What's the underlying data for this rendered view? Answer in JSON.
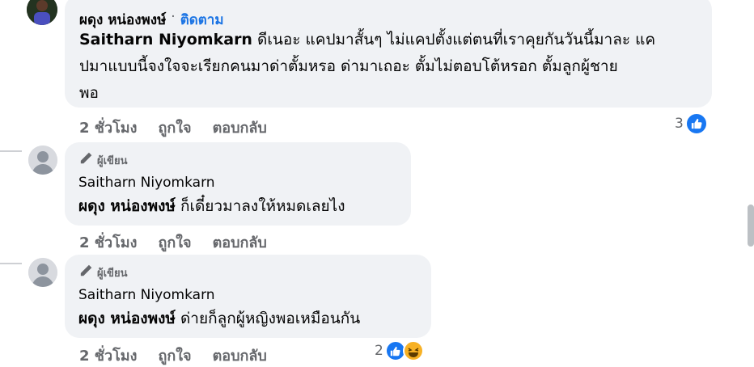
{
  "colors": {
    "link": "#1b74e4",
    "bubble": "#f0f2f5",
    "muted": "#65676b",
    "like": "#1877f2"
  },
  "main_comment": {
    "author": "ผดุง หน่องพงษ์",
    "separator": "·",
    "follow_label": "ติดตาม",
    "mention": "Saitharn Niyomkarn",
    "text_line1": " ดีเนอะ แคปมาสั้นๆ ไม่แคปตั้งแต่ตนที่เราคุยกันวันนี้มาละ แค",
    "text_line2": "ปมาแบบนี้จงใจจะเรียกคนมาด่าตั้มหรอ ด่ามาเถอะ ตั้มไม่ตอบโต้หรอก ตั้มลูกผู้ชาย",
    "text_line3": "พอ",
    "time": "2 ชั่วโมง",
    "like_label": "ถูกใจ",
    "reply_label": "ตอบกลับ",
    "reaction_count": "3",
    "reaction_icons": [
      "like-icon"
    ]
  },
  "replies": [
    {
      "author_badge": "ผู้เขียน",
      "author_badge_icon": "pencil-icon",
      "author": "Saitharn Niyomkarn",
      "mention": "ผดุง หน่องพงษ์",
      "text": " ก็เดี๋ยวมาลงให้หมดเลยไง",
      "time": "2 ชั่วโมง",
      "like_label": "ถูกใจ",
      "reply_label": "ตอบกลับ"
    },
    {
      "author_badge": "ผู้เขียน",
      "author_badge_icon": "pencil-icon",
      "author": "Saitharn Niyomkarn",
      "mention": "ผดุง หน่องพงษ์",
      "text": " ด่ายก็ลูกผู้หญิงพอเหมือนกัน",
      "time": "2 ชั่วโมง",
      "like_label": "ถูกใจ",
      "reply_label": "ตอบกลับ",
      "reaction_count": "2",
      "reaction_icons": [
        "like-icon",
        "haha-icon"
      ]
    }
  ]
}
